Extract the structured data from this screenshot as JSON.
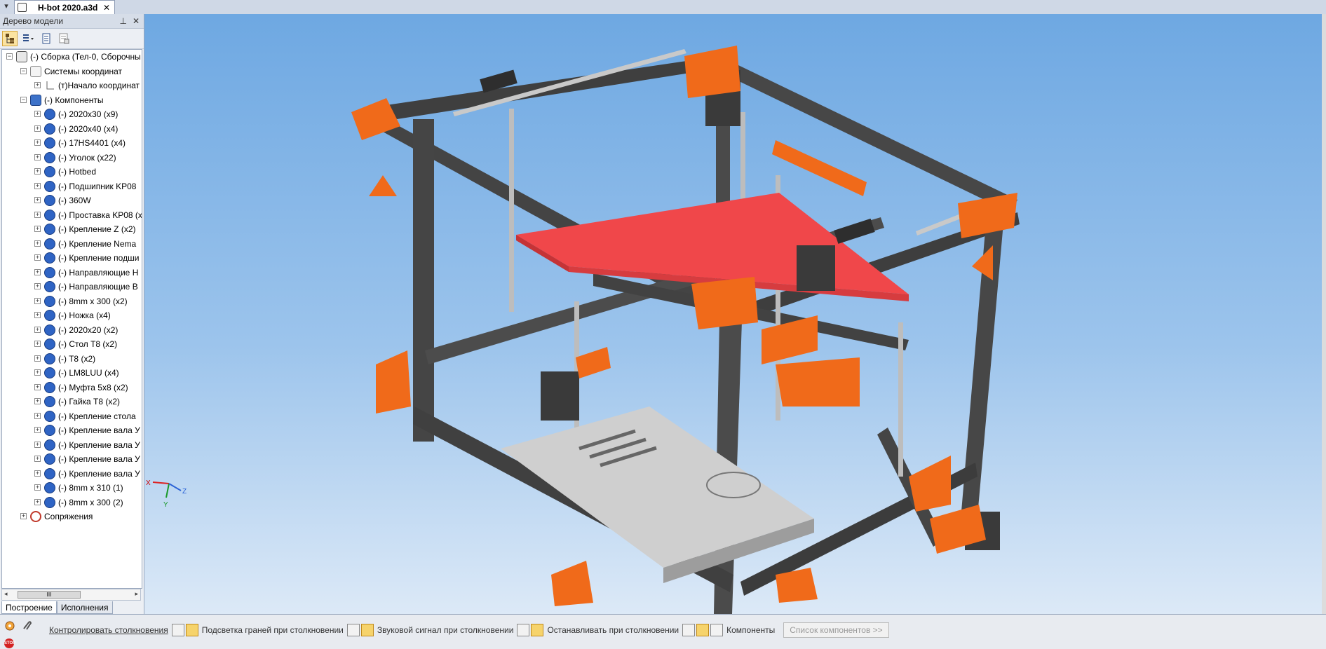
{
  "document": {
    "tab_title": "H-bot 2020.a3d",
    "close_glyph": "✕"
  },
  "panel": {
    "title": "Дерево модели",
    "pin_glyph": "⊥",
    "close_glyph": "✕",
    "tree": [
      {
        "label": "(-) Сборка (Тел-0, Сборочны",
        "icon": "assembly-icon",
        "indent": 0,
        "expander": "−"
      },
      {
        "label": "Системы координат",
        "icon": "coordinate-system-icon",
        "indent": 1,
        "expander": "−"
      },
      {
        "label": "(т)Начало координат",
        "icon": "origin-icon",
        "indent": 2,
        "expander": "+"
      },
      {
        "label": "(-) Компоненты",
        "icon": "components-icon",
        "indent": 1,
        "expander": "−"
      },
      {
        "label": "(-) 2020x30 (x9)",
        "icon": "component-icon",
        "indent": 2,
        "expander": "+"
      },
      {
        "label": "(-) 2020x40 (x4)",
        "icon": "component-icon",
        "indent": 2,
        "expander": "+"
      },
      {
        "label": "(-) 17HS4401 (x4)",
        "icon": "component-icon",
        "indent": 2,
        "expander": "+"
      },
      {
        "label": "(-) Уголок (x22)",
        "icon": "component-icon",
        "indent": 2,
        "expander": "+"
      },
      {
        "label": "(-) Hotbed",
        "icon": "component-icon",
        "indent": 2,
        "expander": "+"
      },
      {
        "label": "(-) Подшипник KP08",
        "icon": "component-icon",
        "indent": 2,
        "expander": "+"
      },
      {
        "label": "(-) 360W",
        "icon": "component-icon",
        "indent": 2,
        "expander": "+"
      },
      {
        "label": "(-) Проставка KP08 (x",
        "icon": "component-icon",
        "indent": 2,
        "expander": "+"
      },
      {
        "label": "(-) Крепление Z (x2)",
        "icon": "component-icon",
        "indent": 2,
        "expander": "+"
      },
      {
        "label": "(-) Крепление Nema",
        "icon": "component-icon",
        "indent": 2,
        "expander": "+"
      },
      {
        "label": "(-) Крепление подши",
        "icon": "component-icon",
        "indent": 2,
        "expander": "+"
      },
      {
        "label": "(-) Направляющие Н",
        "icon": "component-icon",
        "indent": 2,
        "expander": "+"
      },
      {
        "label": "(-) Направляющие В",
        "icon": "component-icon",
        "indent": 2,
        "expander": "+"
      },
      {
        "label": "(-) 8mm x 300 (x2)",
        "icon": "component-icon",
        "indent": 2,
        "expander": "+"
      },
      {
        "label": "(-) Ножка (x4)",
        "icon": "component-icon",
        "indent": 2,
        "expander": "+"
      },
      {
        "label": "(-) 2020x20 (x2)",
        "icon": "component-icon",
        "indent": 2,
        "expander": "+"
      },
      {
        "label": "(-) Стол T8 (x2)",
        "icon": "component-icon",
        "indent": 2,
        "expander": "+"
      },
      {
        "label": "(-) T8 (x2)",
        "icon": "component-icon",
        "indent": 2,
        "expander": "+"
      },
      {
        "label": "(-) LM8LUU (x4)",
        "icon": "component-icon",
        "indent": 2,
        "expander": "+"
      },
      {
        "label": "(-) Муфта 5x8 (x2)",
        "icon": "component-icon",
        "indent": 2,
        "expander": "+"
      },
      {
        "label": "(-) Гайка T8 (x2)",
        "icon": "component-icon",
        "indent": 2,
        "expander": "+"
      },
      {
        "label": "(-) Крепление стола",
        "icon": "component-icon",
        "indent": 2,
        "expander": "+"
      },
      {
        "label": "(-) Крепление вала У",
        "icon": "component-icon",
        "indent": 2,
        "expander": "+"
      },
      {
        "label": "(-) Крепление вала У",
        "icon": "component-icon",
        "indent": 2,
        "expander": "+"
      },
      {
        "label": "(-) Крепление вала У",
        "icon": "component-icon",
        "indent": 2,
        "expander": "+"
      },
      {
        "label": "(-) Крепление вала У",
        "icon": "component-icon",
        "indent": 2,
        "expander": "+"
      },
      {
        "label": "(-) 8mm x 310 (1)",
        "icon": "part-icon",
        "indent": 2,
        "expander": "+"
      },
      {
        "label": "(-) 8mm x 300 (2)",
        "icon": "part-icon",
        "indent": 2,
        "expander": "+"
      },
      {
        "label": "Сопряжения",
        "icon": "mates-icon",
        "indent": 1,
        "expander": "+"
      }
    ],
    "scroll_thumb_glyph": "III",
    "tabs": [
      "Построение",
      "Исполнения"
    ]
  },
  "viewport": {
    "triad": {
      "x_label": "X",
      "y_label": "Y",
      "z_label": "Z"
    },
    "colors": {
      "frame": "#4a4a4a",
      "printed_part": "#f06a1a",
      "bed": "#f0474a",
      "rod": "#c9c9c9",
      "motor": "#3a3a3a",
      "psu": "#c8c8c8"
    }
  },
  "bottombar": {
    "items": [
      {
        "label": "Контролировать столкновения",
        "underline": true
      },
      {
        "label": "Подсветка граней при столкновении",
        "underline": false
      },
      {
        "label": "Звуковой сигнал при столкновении",
        "underline": false
      },
      {
        "label": "Останавливать при столкновении",
        "underline": false
      },
      {
        "label": "Компоненты",
        "underline": false
      }
    ],
    "components_list_button": "Список компонентов >>",
    "stop_label": "STOP"
  }
}
